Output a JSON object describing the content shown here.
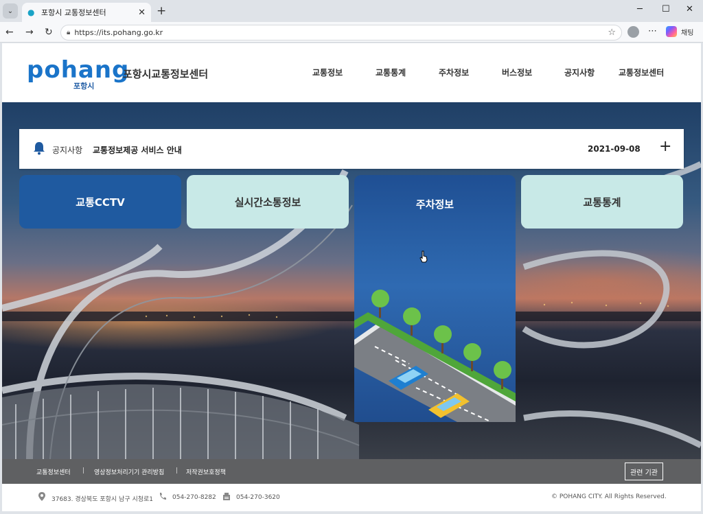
{
  "browser": {
    "tab_title": "포항시 교통정보센터",
    "url": "https://its.pohang.go.kr",
    "chat_label": "채팅"
  },
  "header": {
    "logo_text": "pohang",
    "logo_sub": "포항시",
    "site_title": "포항시교통정보센터",
    "nav": [
      "교통정보",
      "교통통계",
      "주차정보",
      "버스정보",
      "공지사항",
      "교통정보센터"
    ]
  },
  "notice": {
    "label": "공지사항",
    "message": "교통정보제공 서비스 안내",
    "date": "2021-09-08",
    "more_symbol": "+"
  },
  "cards": [
    {
      "label": "교통CCTV"
    },
    {
      "label": "실시간소통정보"
    },
    {
      "label": "주차정보"
    },
    {
      "label": "교통통계"
    }
  ],
  "footer": {
    "links": [
      "교통정보센터",
      "영상정보처리기기 관리방침",
      "저작권보호정책"
    ],
    "separator": "|",
    "related_button": "관련 기관",
    "address": "37683. 경상북도 포항시 남구 시청로1",
    "phone": "054-270-8282",
    "fax": "054-270-3620",
    "copyright": "© POHANG CITY. All Rights Reserved."
  }
}
